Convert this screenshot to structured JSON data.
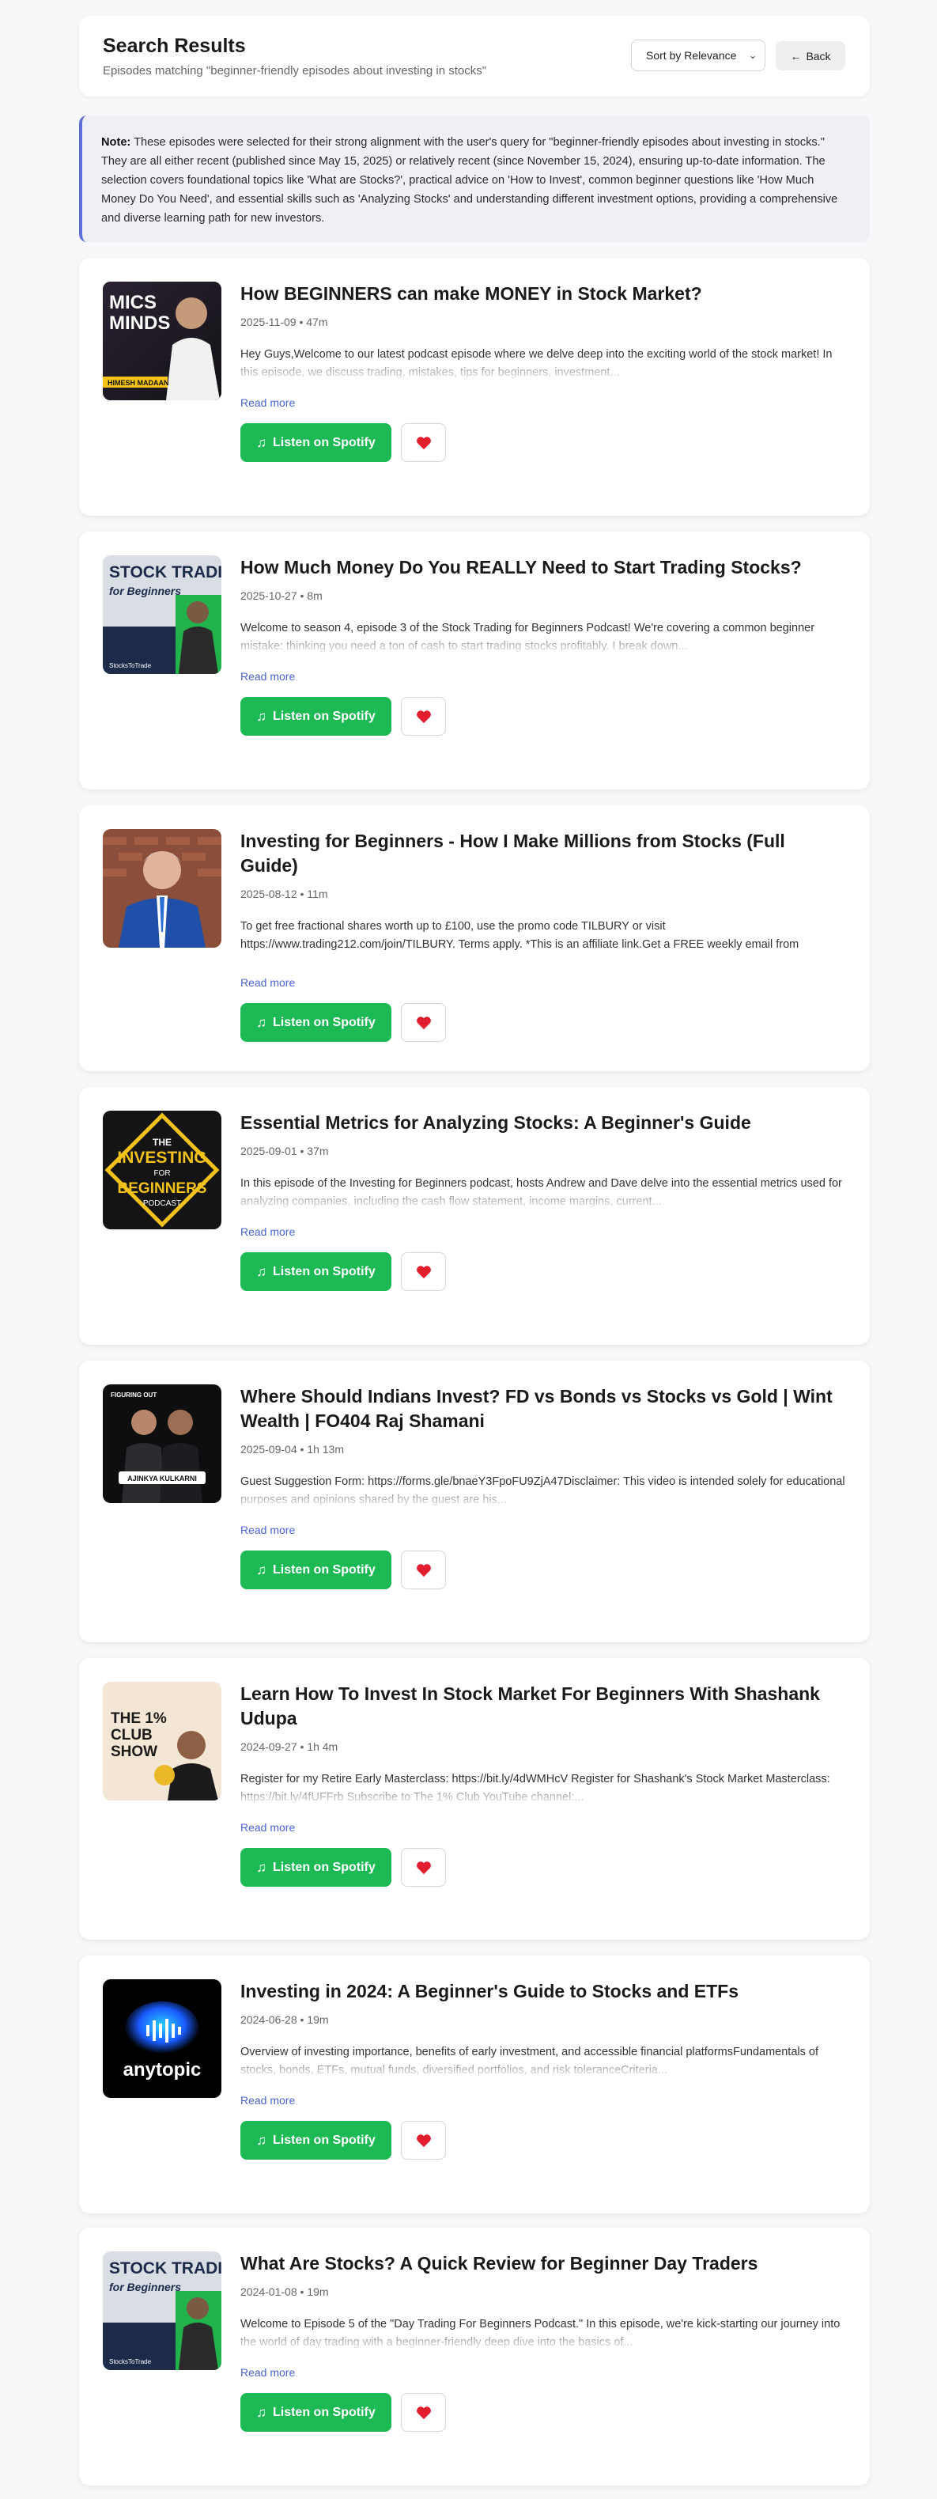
{
  "header": {
    "title": "Search Results",
    "subtitle": "Episodes matching \"beginner-friendly episodes about investing in stocks\"",
    "sort_label": "Sort by Relevance",
    "back_label": "Back"
  },
  "note": {
    "label": "Note:",
    "text": " These episodes were selected for their strong alignment with the user's query for \"beginner-friendly episodes about investing in stocks.\" They are all either recent (published since May 15, 2025) or relatively recent (since November 15, 2024), ensuring up-to-date information. The selection covers foundational topics like 'What are Stocks?', practical advice on 'How to Invest', common beginner questions like 'How Much Money Do You Need', and essential skills such as 'Analyzing Stocks' and understanding different investment options, providing a comprehensive and diverse learning path for new investors."
  },
  "common": {
    "read_more": "Read more",
    "listen_label": "Listen on Spotify"
  },
  "episodes": [
    {
      "title": "How BEGINNERS can make MONEY in Stock Market?",
      "meta": "2025-11-09 • 47m",
      "description": "Hey Guys,Welcome to our latest podcast episode where we delve deep into the exciting world of the stock market! In this episode, we discuss trading, mistakes, tips for beginners, investment...",
      "thumb": {
        "line1": "MICS",
        "line2": "MINDS",
        "tag": "HIMESH MADAAN"
      }
    },
    {
      "title": "How Much Money Do You REALLY Need to Start Trading Stocks?",
      "meta": "2025-10-27 • 8m",
      "description": "Welcome to season 4, episode 3 of the Stock Trading for Beginners Podcast! We're covering a common beginner mistake: thinking you need a ton of cash to start trading stocks profitably. I break down...",
      "thumb": {
        "line1": "STOCK TRADING",
        "line2": "for Beginners",
        "tag": "StocksToTrade"
      }
    },
    {
      "title": "Investing for Beginners - How I Make Millions from Stocks (Full Guide)",
      "meta": "2025-08-12 • 11m",
      "description": "To get free fractional shares worth up to £100, use the promo code TILBURY or visit https://www.trading212.com/join/TILBURY. Terms apply. *This is an affiliate link.Get a FREE weekly email from",
      "thumb": {}
    },
    {
      "title": "Essential Metrics for Analyzing Stocks: A Beginner's Guide",
      "meta": "2025-09-01 • 37m",
      "description": "In this episode of the Investing for Beginners podcast, hosts Andrew and Dave delve into the essential metrics used for analyzing companies, including the cash flow statement, income margins, current...",
      "thumb": {
        "line1": "THE",
        "line2": "INVESTING",
        "line3": "FOR",
        "line4": "BEGINNERS",
        "line5": "PODCAST"
      }
    },
    {
      "title": "Where Should Indians Invest? FD vs Bonds vs Stocks vs Gold | Wint Wealth | FO404 Raj Shamani",
      "meta": "2025-09-04 • 1h 13m",
      "description": "Guest Suggestion Form: https://forms.gle/bnaeY3FpoFU9ZjA47Disclaimer: This video is intended solely for educational purposes and opinions shared by the guest are his...",
      "thumb": {
        "tag": "AJINKYA KULKARNI",
        "brand": "FIGURING OUT"
      }
    },
    {
      "title": "Learn How To Invest In Stock Market For Beginners With Shashank Udupa",
      "meta": "2024-09-27 • 1h 4m",
      "description": "Register for my Retire Early Masterclass: https://bit.ly/4dWMHcV Register for Shashank's Stock Market Masterclass: https://bit.ly/4fUFFrb Subscribe to The 1% Club YouTube channel:...",
      "thumb": {
        "line1": "THE 1%",
        "line2": "CLUB",
        "line3": "SHOW"
      }
    },
    {
      "title": "Investing in 2024: A Beginner's Guide to Stocks and ETFs",
      "meta": "2024-06-28 • 19m",
      "description": "Overview of investing importance, benefits of early investment, and accessible financial platformsFundamentals of stocks, bonds, ETFs, mutual funds, diversified portfolios, and risk toleranceCriteria...",
      "thumb": {
        "line1": "anytopic"
      }
    },
    {
      "title": "What Are Stocks? A Quick Review for Beginner Day Traders",
      "meta": "2024-01-08 • 19m",
      "description": "Welcome to Episode 5 of the \"Day Trading For Beginners Podcast.\" In this episode, we're kick-starting our journey into the world of day trading with a beginner-friendly deep dive into the basics of...",
      "thumb": {
        "line1": "STOCK TRADING",
        "line2": "for Beginners",
        "tag": "StocksToTrade"
      }
    }
  ],
  "colors": {
    "spotify_green": "#1db954",
    "link_blue": "#4a63d6",
    "note_border": "#5b6fd8"
  }
}
